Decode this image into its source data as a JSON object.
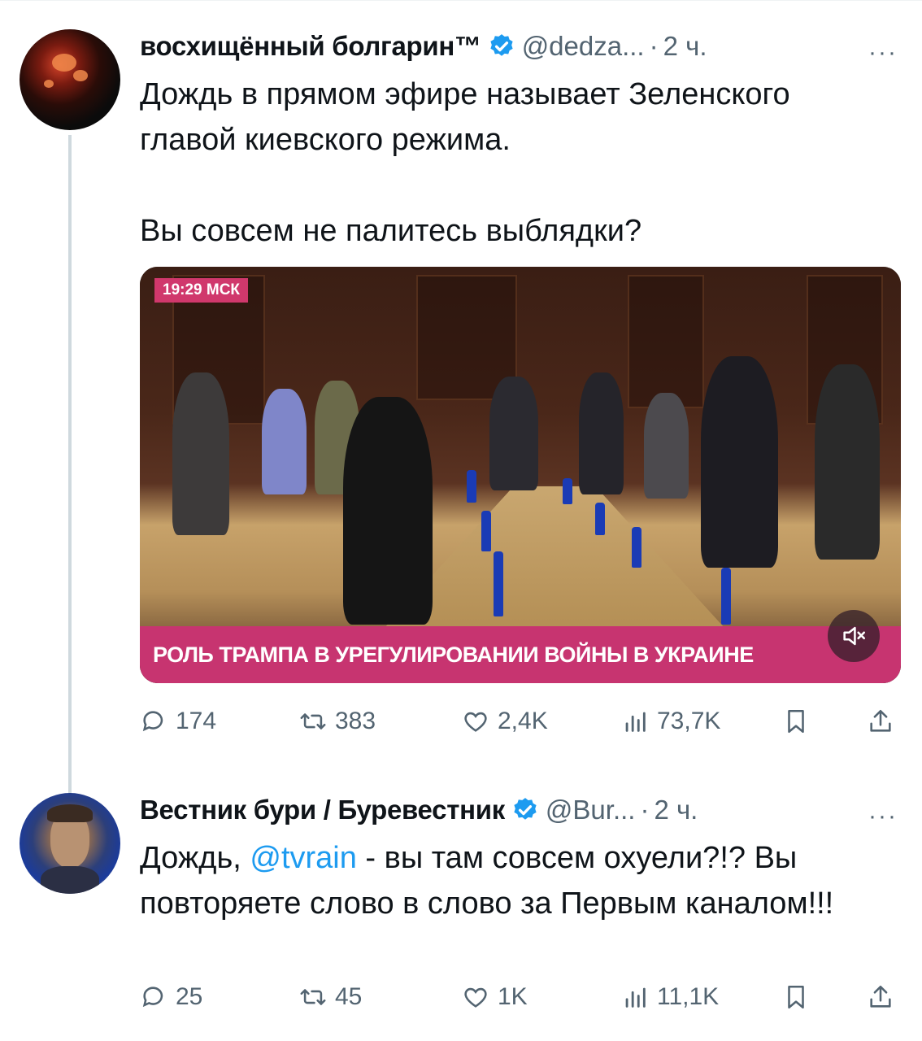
{
  "tweets": [
    {
      "author_name": "восхищённый болгарин™",
      "handle": "@dedza...",
      "separator": "·",
      "time": "2 ч.",
      "more": "···",
      "text_lines": [
        "Дождь в прямом эфире называет Зеленского",
        "главой киевского режима."
      ],
      "text_para2": "Вы совсем не палитесь выблядки?",
      "media": {
        "time_badge": "19:29 МСК",
        "ticker": "РОЛЬ ТРАМПА В УРЕГУЛИРОВАНИИ ВОЙНЫ В УКРАИНЕ",
        "mute_icon": "muted-speaker-icon"
      },
      "actions": {
        "replies": "174",
        "reposts": "383",
        "likes": "2,4K",
        "views": "73,7K"
      }
    },
    {
      "author_name": "Вестник бури / Буревестник",
      "handle": "@Bur...",
      "separator": "·",
      "time": "2 ч.",
      "more": "···",
      "text_start": "Дождь, ",
      "mention": "@tvrain",
      "text_rest": " - вы там совсем охуели?!? Вы повторяете слово в слово за Первым каналом!!!",
      "actions": {
        "replies": "25",
        "reposts": "45",
        "likes": "1K",
        "views": "11,1K"
      }
    }
  ],
  "colors": {
    "verified": "#1d9bf0",
    "link": "#1d9bf0",
    "muted_text": "#536471",
    "ticker_bg": "#c73470"
  }
}
